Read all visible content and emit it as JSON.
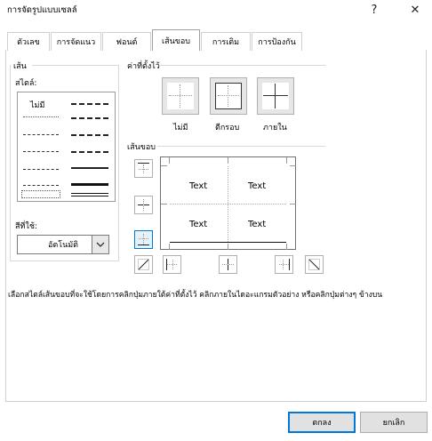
{
  "window": {
    "title": "การจัดรูปแบบเซลล์",
    "help_glyph": "?",
    "close_glyph": "✕"
  },
  "tabs": [
    {
      "label": "ตัวเลข",
      "active": false
    },
    {
      "label": "การจัดแนว",
      "active": false
    },
    {
      "label": "ฟอนต์",
      "active": false
    },
    {
      "label": "เส้นขอบ",
      "active": true
    },
    {
      "label": "การเติม",
      "active": false
    },
    {
      "label": "การป้องกัน",
      "active": false
    }
  ],
  "line_group": {
    "title": "เส้น",
    "style_label": "สไตล์:",
    "none_label": "ไม่มี",
    "color_label": "สีที่ใช้:",
    "color_value": "อัตโนมัติ"
  },
  "presets": {
    "title": "ค่าที่ตั้งไว้",
    "items": [
      {
        "label": "ไม่มี",
        "icon": "preset-none-icon"
      },
      {
        "label": "ตีกรอบ",
        "icon": "preset-outline-icon"
      },
      {
        "label": "ภายใน",
        "icon": "preset-inside-icon"
      }
    ]
  },
  "border_group": {
    "title": "เส้นขอบ"
  },
  "preview": {
    "cells": [
      "Text",
      "Text",
      "Text",
      "Text"
    ]
  },
  "hint": "เลือกสไตล์เส้นขอบที่จะใช้โดยการคลิกปุ่มภายใต้ค่าที่ตั้งไว้ คลิกภายในไดอะแกรมตัวอย่าง หรือคลิกปุ่มต่างๆ ข้างบน",
  "footer": {
    "ok": "ตกลง",
    "cancel": "ยกเลิก"
  },
  "colors": {
    "accent": "#0078d7",
    "selected_bg": "#e5f1fb",
    "button_bg": "#e1e1e1"
  }
}
